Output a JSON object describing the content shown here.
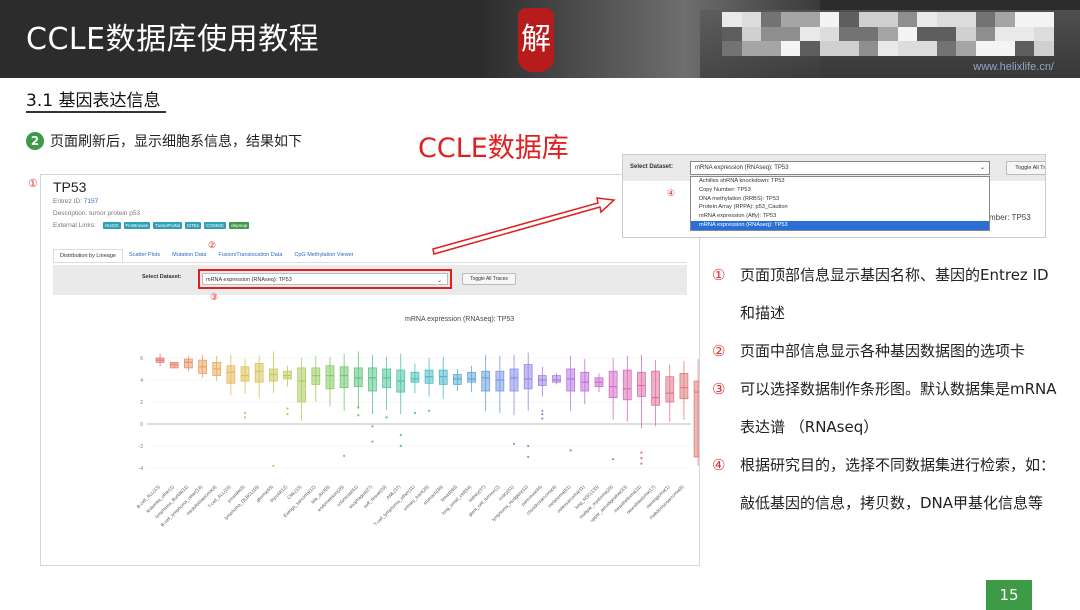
{
  "header": {
    "title": "CCLE数据库使用教程",
    "logo_text": "解",
    "url": "www.helixlife.cn/"
  },
  "section": {
    "heading": "3.1 基因表达信息",
    "step_number": "2",
    "step_text": "页面刷新后，显示细胞系信息，结果如下",
    "red_title": "CCLE数据库"
  },
  "markers": {
    "m1": "①",
    "m2": "②",
    "m3": "③",
    "m4": "④"
  },
  "gene_panel": {
    "gene": "TP53",
    "entrez_label": "Entrez ID:",
    "entrez_id": "7157",
    "description": "Description: tumor protein p53",
    "external_label": "External Links:",
    "external_links": [
      "HUGO",
      "FireBrowse",
      "TumorPortal",
      "ISTEx",
      "COSMIC",
      "depmap"
    ],
    "tabs": [
      "Distribution by Lineage",
      "Scatter Plots",
      "Mutation Data",
      "Fusion/Translocation Data",
      "CpG Methylation Viewer"
    ],
    "select_label": "Select Dataset:",
    "selected_dataset": "mRNA expression (RNAseq): TP53",
    "toggle_button": "Toggle All Traces",
    "plot_title": "mRNA expression (RNAseq): TP53"
  },
  "dropdown_panel": {
    "select_label": "Select Dataset:",
    "selected": "mRNA expression (RNAseq): TP53",
    "toggle_button": "Toggle All Traces",
    "options": [
      "Achilles shRNA knockdown: TP53",
      "Copy Number: TP53",
      "DNA methylation (RRBS): TP53",
      "Protein Array (RPPA): p53_Caution",
      "mRNA expression (Affy): TP53",
      "mRNA expression (RNAseq): TP53"
    ],
    "selected_index": 5,
    "partial_text": "mber: TP53"
  },
  "notes": [
    {
      "mark": "①",
      "text": "页面顶部信息显示基因名称、基因的Entrez ID和描述"
    },
    {
      "mark": "②",
      "text": "页面中部信息显示各种基因数据图的选项卡"
    },
    {
      "mark": "③",
      "text": "可以选择数据制作条形图。默认数据集是mRNA 表达谱 （RNAseq）"
    },
    {
      "mark": "④",
      "text": "根据研究目的，选择不同数据集进行检索，如：敲低基因的信息，拷贝数，DNA甲基化信息等"
    }
  ],
  "page_number": "15",
  "colors": {
    "accent_red": "#e02020",
    "accent_green": "#3d9a46",
    "header_bg": "#2c2c2c"
  },
  "chart_data": {
    "type": "box",
    "title": "mRNA expression (RNAseq): TP53",
    "ylim": [
      -5,
      7
    ],
    "yticks": [
      -4,
      -2,
      0,
      2,
      4,
      6
    ],
    "categories": [
      "B-cell_ALL(13)",
      "leukemia_other(1)",
      "lymphoma_Burkitt(11)",
      "B-cell_lymphoma_other(14)",
      "medulloblastoma(4)",
      "T-cell_ALL(16)",
      "prostate(8)",
      "lymphoma_DLBCL(18)",
      "glioma(65)",
      "thyroid(12)",
      "CML(15)",
      "Ewings_sarcoma(12)",
      "bile_duct(8)",
      "endometrium(28)",
      "colorectal(61)",
      "esophagus(27)",
      "soft_tissue(20)",
      "AML(37)",
      "T-cell_lymphoma_other(11)",
      "urinary_tract(28)",
      "stomach(38)",
      "breast(60)",
      "lung_small_cell(54)",
      "kidney(37)",
      "giant_cell_tumour(2)",
      "ovary(51)",
      "lymphoma_Hodgkin(12)",
      "pancreas(44)",
      "chondrosarcoma(4)",
      "melanoma(61)",
      "osteosarcoma(11)",
      "lung_NSC(135)",
      "multiple_myeloma(29)",
      "upper_aerodigestive(33)",
      "mesothelioma(11)",
      "neuroblastoma(17)",
      "meningioma(1)",
      "rhabdomyosarcoma(8)"
    ],
    "series": [
      {
        "q1": 5.6,
        "q3": 6.0,
        "median": 5.8,
        "min": 5.2,
        "max": 6.4,
        "outliers": []
      },
      {
        "q1": 5.1,
        "q3": 5.6,
        "median": 5.4,
        "min": 5.1,
        "max": 5.6,
        "outliers": []
      },
      {
        "q1": 5.1,
        "q3": 5.9,
        "median": 5.6,
        "min": 4.8,
        "max": 6.2,
        "outliers": []
      },
      {
        "q1": 4.6,
        "q3": 5.8,
        "median": 5.2,
        "min": 4.2,
        "max": 6.3,
        "outliers": []
      },
      {
        "q1": 4.4,
        "q3": 5.6,
        "median": 5.0,
        "min": 3.9,
        "max": 6.2,
        "outliers": []
      },
      {
        "q1": 3.7,
        "q3": 5.3,
        "median": 4.7,
        "min": 2.6,
        "max": 6.3,
        "outliers": []
      },
      {
        "q1": 3.9,
        "q3": 5.2,
        "median": 4.4,
        "min": 2.8,
        "max": 5.9,
        "outliers": [
          0.6,
          1.0
        ]
      },
      {
        "q1": 3.8,
        "q3": 5.5,
        "median": 4.8,
        "min": 2.4,
        "max": 6.2,
        "outliers": []
      },
      {
        "q1": 3.9,
        "q3": 5.0,
        "median": 4.5,
        "min": 2.8,
        "max": 6.6,
        "outliers": [
          -3.8
        ]
      },
      {
        "q1": 4.1,
        "q3": 4.8,
        "median": 4.4,
        "min": 3.4,
        "max": 5.3,
        "outliers": [
          0.9,
          1.4
        ]
      },
      {
        "q1": 2.0,
        "q3": 5.1,
        "median": 3.9,
        "min": 0.3,
        "max": 6.0,
        "outliers": []
      },
      {
        "q1": 3.6,
        "q3": 5.1,
        "median": 4.4,
        "min": 2.0,
        "max": 6.2,
        "outliers": []
      },
      {
        "q1": 3.2,
        "q3": 5.3,
        "median": 4.4,
        "min": 1.6,
        "max": 6.1,
        "outliers": []
      },
      {
        "q1": 3.3,
        "q3": 5.2,
        "median": 4.4,
        "min": 1.2,
        "max": 6.4,
        "outliers": [
          -2.9
        ]
      },
      {
        "q1": 3.4,
        "q3": 5.1,
        "median": 4.2,
        "min": 1.4,
        "max": 6.6,
        "outliers": [
          0.8,
          1.5
        ]
      },
      {
        "q1": 3.0,
        "q3": 5.1,
        "median": 4.2,
        "min": 0.9,
        "max": 6.3,
        "outliers": [
          -0.2,
          -1.6
        ]
      },
      {
        "q1": 3.3,
        "q3": 5.0,
        "median": 4.2,
        "min": 1.3,
        "max": 6.1,
        "outliers": [
          0.6
        ]
      },
      {
        "q1": 2.9,
        "q3": 4.9,
        "median": 3.9,
        "min": 0.9,
        "max": 6.4,
        "outliers": [
          -1.0,
          -2.0
        ]
      },
      {
        "q1": 3.8,
        "q3": 4.7,
        "median": 4.1,
        "min": 2.8,
        "max": 5.5,
        "outliers": [
          1.0
        ]
      },
      {
        "q1": 3.7,
        "q3": 4.9,
        "median": 4.3,
        "min": 2.5,
        "max": 6.0,
        "outliers": [
          1.2
        ]
      },
      {
        "q1": 3.6,
        "q3": 4.9,
        "median": 4.3,
        "min": 2.3,
        "max": 6.1,
        "outliers": []
      },
      {
        "q1": 3.6,
        "q3": 4.5,
        "median": 4.1,
        "min": 3.0,
        "max": 5.0,
        "outliers": []
      },
      {
        "q1": 3.8,
        "q3": 4.7,
        "median": 4.1,
        "min": 2.9,
        "max": 5.3,
        "outliers": []
      },
      {
        "q1": 3.0,
        "q3": 4.8,
        "median": 4.2,
        "min": 1.2,
        "max": 6.3,
        "outliers": []
      },
      {
        "q1": 3.0,
        "q3": 4.8,
        "median": 4.0,
        "min": 1.0,
        "max": 6.2,
        "outliers": []
      },
      {
        "q1": 3.0,
        "q3": 5.0,
        "median": 4.2,
        "min": 0.8,
        "max": 6.3,
        "outliers": [
          -1.8
        ]
      },
      {
        "q1": 3.2,
        "q3": 5.4,
        "median": 4.1,
        "min": 1.2,
        "max": 6.5,
        "outliers": [
          -2.0,
          -3.0
        ]
      },
      {
        "q1": 3.5,
        "q3": 4.4,
        "median": 4.0,
        "min": 2.5,
        "max": 5.2,
        "outliers": [
          0.5,
          0.9,
          1.2
        ]
      },
      {
        "q1": 3.8,
        "q3": 4.4,
        "median": 4.0,
        "min": 3.6,
        "max": 4.6,
        "outliers": []
      },
      {
        "q1": 3.0,
        "q3": 5.0,
        "median": 4.1,
        "min": 1.2,
        "max": 6.2,
        "outliers": [
          -2.4
        ]
      },
      {
        "q1": 3.0,
        "q3": 4.7,
        "median": 3.8,
        "min": 1.8,
        "max": 5.9,
        "outliers": []
      },
      {
        "q1": 3.4,
        "q3": 4.2,
        "median": 3.8,
        "min": 2.9,
        "max": 4.6,
        "outliers": []
      },
      {
        "q1": 2.4,
        "q3": 4.8,
        "median": 3.4,
        "min": 0.4,
        "max": 6.0,
        "outliers": [
          -3.2
        ]
      },
      {
        "q1": 2.2,
        "q3": 4.9,
        "median": 3.2,
        "min": 0.2,
        "max": 6.2,
        "outliers": []
      },
      {
        "q1": 2.5,
        "q3": 4.7,
        "median": 3.5,
        "min": -0.4,
        "max": 6.3,
        "outliers": [
          -2.6,
          -3.1,
          -3.6
        ]
      },
      {
        "q1": 1.7,
        "q3": 4.8,
        "median": 2.4,
        "min": -0.2,
        "max": 5.8,
        "outliers": []
      },
      {
        "q1": 2.0,
        "q3": 4.3,
        "median": 2.8,
        "min": 0.2,
        "max": 5.4,
        "outliers": []
      },
      {
        "q1": 2.3,
        "q3": 4.6,
        "median": 3.3,
        "min": 0.4,
        "max": 5.7,
        "outliers": []
      },
      {
        "q1": -3.0,
        "q3": 3.9,
        "median": 2.9,
        "min": -3.8,
        "max": 5.9,
        "outliers": []
      }
    ]
  }
}
